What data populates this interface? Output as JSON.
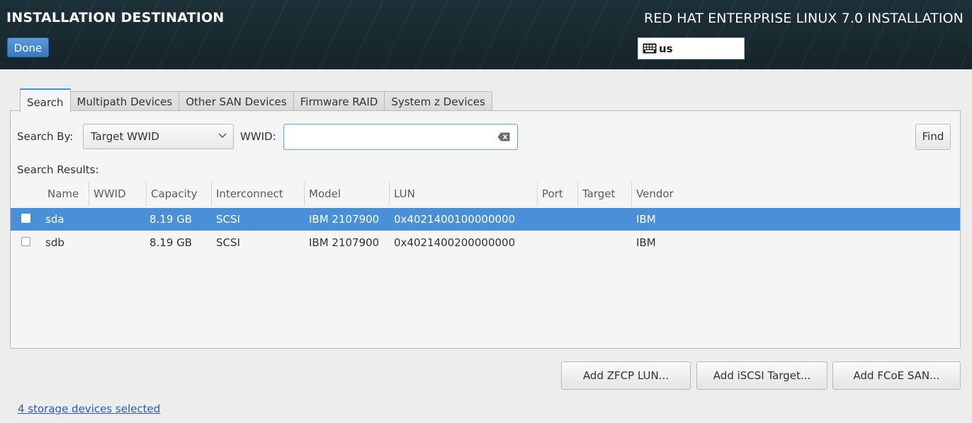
{
  "header": {
    "title": "INSTALLATION DESTINATION",
    "done_label": "Done",
    "product": "RED HAT ENTERPRISE LINUX 7.0 INSTALLATION",
    "keyboard_layout": "us",
    "keyboard_icon": "keyboard-icon"
  },
  "tabs": [
    {
      "label": "Search",
      "active": true
    },
    {
      "label": "Multipath Devices",
      "active": false
    },
    {
      "label": "Other SAN Devices",
      "active": false
    },
    {
      "label": "Firmware RAID",
      "active": false
    },
    {
      "label": "System z Devices",
      "active": false
    }
  ],
  "search": {
    "search_by_label": "Search By:",
    "search_by_value": "Target WWID",
    "wwid_label": "WWID:",
    "wwid_value": "",
    "find_label": "Find",
    "results_label": "Search Results:"
  },
  "table": {
    "columns": [
      "Name",
      "WWID",
      "Capacity",
      "Interconnect",
      "Model",
      "LUN",
      "Port",
      "Target",
      "Vendor"
    ],
    "rows": [
      {
        "name": "sda",
        "wwid": "",
        "capacity": "8.19 GB",
        "interconnect": "SCSI",
        "model": "IBM 2107900",
        "lun": "0x4021400100000000",
        "port": "",
        "target": "",
        "vendor": "IBM",
        "selected": true,
        "checked": false
      },
      {
        "name": "sdb",
        "wwid": "",
        "capacity": "8.19 GB",
        "interconnect": "SCSI",
        "model": "IBM 2107900",
        "lun": "0x4021400200000000",
        "port": "",
        "target": "",
        "vendor": "IBM",
        "selected": false,
        "checked": false
      }
    ]
  },
  "actions": {
    "add_zfcp": "Add ZFCP LUN...",
    "add_iscsi": "Add iSCSI Target...",
    "add_fcoe": "Add FCoE SAN..."
  },
  "status": {
    "selected_text": "4 storage devices selected"
  },
  "colors": {
    "header_bg": "#1b2c33",
    "accent": "#4a90d9",
    "link": "#2a5db0"
  }
}
